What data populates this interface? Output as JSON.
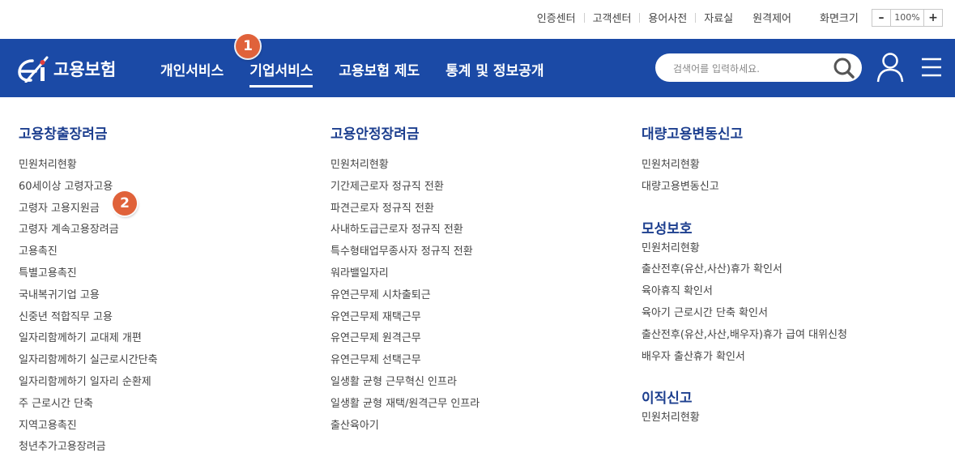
{
  "utility": {
    "links": [
      "인증센터",
      "고객센터",
      "용어사전",
      "자료실",
      "원격제어"
    ],
    "zoom_label": "화면크기",
    "zoom_minus": "–",
    "zoom_value": "100%",
    "zoom_plus": "+"
  },
  "header": {
    "logo_text": "고용보험",
    "nav": [
      "개인서비스",
      "기업서비스",
      "고용보험 제도",
      "통계 및 정보공개"
    ],
    "active_nav": "기업서비스",
    "search_placeholder": "검색어를 입력하세요."
  },
  "badges": [
    "1",
    "2"
  ],
  "menu": {
    "col1": {
      "title": "고용창출장려금",
      "items": [
        "민원처리현황",
        "60세이상 고령자고용",
        "고령자 고용지원금",
        "고령자 계속고용장려금",
        "고용촉진",
        "특별고용촉진",
        "국내복귀기업 고용",
        "신중년 적합직무 고용",
        "일자리함께하기 교대제 개편",
        "일자리함께하기 실근로시간단축",
        "일자리함께하기 일자리 순환제",
        "주 근로시간 단축",
        "지역고용촉진",
        "청년추가고용장려금"
      ]
    },
    "col2": {
      "title": "고용안정장려금",
      "items": [
        "민원처리현황",
        "기간제근로자 정규직 전환",
        "파견근로자 정규직 전환",
        "사내하도급근로자 정규직 전환",
        "특수형태업무종사자 정규직 전환",
        "워라밸일자리",
        "유연근무제 시차출퇴근",
        "유연근무제 재택근무",
        "유연근무제 원격근무",
        "유연근무제 선택근무",
        "일생활 균형 근무혁신 인프라",
        "일생활 균형 재택/원격근무 인프라",
        "출산육아기"
      ]
    },
    "col3": [
      {
        "title": "대량고용변동신고",
        "items": [
          "민원처리현황",
          "대량고용변동신고"
        ]
      },
      {
        "title": "모성보호",
        "items": [
          "민원처리현황",
          "출산전후(유산,사산)휴가 확인서",
          "육아휴직 확인서",
          "육아기 근로시간 단축 확인서",
          "출산전후(유산,사산,배우자)휴가 급여 대위신청",
          "배우자 출산휴가 확인서"
        ]
      },
      {
        "title": "이직신고",
        "items": [
          "민원처리현황"
        ]
      }
    ]
  }
}
